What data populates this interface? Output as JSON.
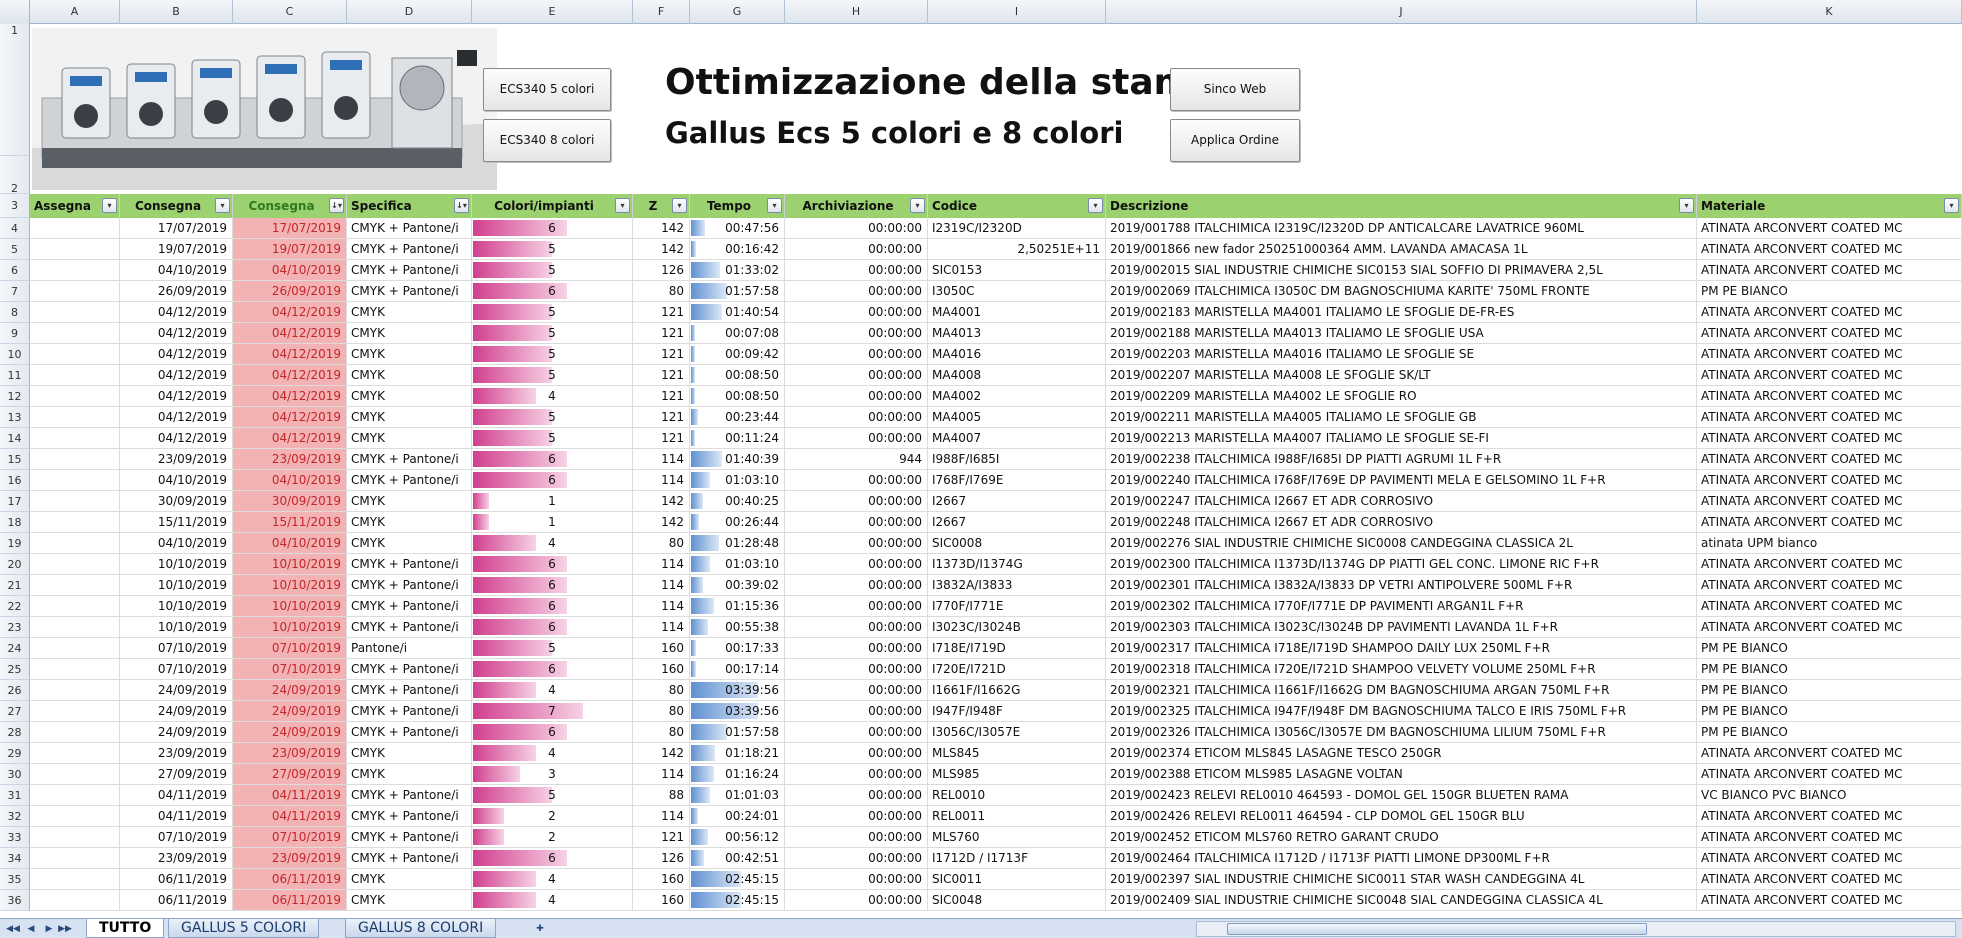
{
  "columns": [
    "A",
    "B",
    "C",
    "D",
    "E",
    "F",
    "G",
    "H",
    "I",
    "J",
    "K"
  ],
  "row_numbers": [
    "1",
    "2",
    "3",
    "4",
    "5",
    "6",
    "7",
    "8",
    "9",
    "10",
    "11",
    "12",
    "13",
    "14",
    "15",
    "16",
    "17",
    "18",
    "19",
    "20",
    "21",
    "22",
    "23",
    "24",
    "25",
    "26",
    "27",
    "28",
    "29",
    "30",
    "31",
    "32",
    "33",
    "34",
    "35",
    "36"
  ],
  "buttons": {
    "ecs5": "ECS340 5 colori",
    "ecs8": "ECS340 8 colori",
    "sinco": "Sinco Web",
    "applica": "Applica Ordine"
  },
  "title": {
    "line1": "Ottimizzazione della stampa",
    "line2": "Gallus Ecs 5 colori e 8 colori"
  },
  "headers": {
    "assegna": "Assegna",
    "consegna": "Consegna",
    "consegna2": "Consegna",
    "specifica": "Specifica",
    "colori": "Colori/impianti",
    "z": "Z",
    "tempo": "Tempo",
    "archiviazione": "Archiviazione",
    "codice": "Codice",
    "descrizione": "Descrizione",
    "materiale": "Materiale"
  },
  "colors": {
    "header_green": "#9bd16f",
    "pink_fill": "#f3b2b4",
    "pink_text": "#c3262b",
    "bar_pink": "#d13f8e",
    "bar_blue": "#5f90d1"
  },
  "rows": [
    {
      "b": "17/07/2019",
      "c": "17/07/2019",
      "d": "CMYK + Pantone/i",
      "e": "6",
      "f": "142",
      "g": "00:47:56",
      "h": "00:00:00",
      "i": "I2319C/I2320D",
      "j": "2019/001788 ITALCHIMICA I2319C/I2320D DP ANTICALCARE LAVATRICE 960ML",
      "k": "ATINATA ARCONVERT COATED MC",
      "t": 0.12
    },
    {
      "b": "19/07/2019",
      "c": "19/07/2019",
      "d": "CMYK + Pantone/i",
      "e": "5",
      "f": "142",
      "g": "00:16:42",
      "h": "00:00:00",
      "i": "2,50251E+11",
      "j": "2019/001866 new fador 250251000364 AMM. LAVANDA AMACASA 1L",
      "k": "ATINATA ARCONVERT COATED MC",
      "t": 0.04
    },
    {
      "b": "04/10/2019",
      "c": "04/10/2019",
      "d": "CMYK + Pantone/i",
      "e": "5",
      "f": "126",
      "g": "01:33:02",
      "h": "00:00:00",
      "i": "SIC0153",
      "j": "2019/002015 SIAL INDUSTRIE CHIMICHE SIC0153 SIAL SOFFIO DI PRIMAVERA 2,5L",
      "k": "ATINATA ARCONVERT COATED MC",
      "t": 0.24
    },
    {
      "b": "26/09/2019",
      "c": "26/09/2019",
      "d": "CMYK + Pantone/i",
      "e": "6",
      "f": "80",
      "g": "01:57:58",
      "h": "00:00:00",
      "i": "I3050C",
      "j": "2019/002069 ITALCHIMICA I3050C DM BAGNOSCHIUMA KARITE' 750ML FRONTE",
      "k": "PM PE BIANCO",
      "t": 0.3
    },
    {
      "b": "04/12/2019",
      "c": "04/12/2019",
      "d": "CMYK",
      "e": "5",
      "f": "121",
      "g": "01:40:54",
      "h": "00:00:00",
      "i": "MA4001",
      "j": "2019/002183 MARISTELLA MA4001 ITALIAMO LE SFOGLIE DE-FR-ES",
      "k": "ATINATA ARCONVERT COATED MC",
      "t": 0.26
    },
    {
      "b": "04/12/2019",
      "c": "04/12/2019",
      "d": "CMYK",
      "e": "5",
      "f": "121",
      "g": "00:07:08",
      "h": "00:00:00",
      "i": "MA4013",
      "j": "2019/002188 MARISTELLA MA4013 ITALIAMO LE SFOGLIE USA",
      "k": "ATINATA ARCONVERT COATED MC",
      "t": 0.02
    },
    {
      "b": "04/12/2019",
      "c": "04/12/2019",
      "d": "CMYK",
      "e": "5",
      "f": "121",
      "g": "00:09:42",
      "h": "00:00:00",
      "i": "MA4016",
      "j": "2019/002203 MARISTELLA MA4016 ITALIAMO LE SFOGLIE SE",
      "k": "ATINATA ARCONVERT COATED MC",
      "t": 0.03
    },
    {
      "b": "04/12/2019",
      "c": "04/12/2019",
      "d": "CMYK",
      "e": "5",
      "f": "121",
      "g": "00:08:50",
      "h": "00:00:00",
      "i": "MA4008",
      "j": "2019/002207 MARISTELLA MA4008 LE SFOGLIE SK/LT",
      "k": "ATINATA ARCONVERT COATED MC",
      "t": 0.02
    },
    {
      "b": "04/12/2019",
      "c": "04/12/2019",
      "d": "CMYK",
      "e": "4",
      "f": "121",
      "g": "00:08:50",
      "h": "00:00:00",
      "i": "MA4002",
      "j": "2019/002209 MARISTELLA MA4002 LE SFOGLIE RO",
      "k": "ATINATA ARCONVERT COATED MC",
      "t": 0.02
    },
    {
      "b": "04/12/2019",
      "c": "04/12/2019",
      "d": "CMYK",
      "e": "5",
      "f": "121",
      "g": "00:23:44",
      "h": "00:00:00",
      "i": "MA4005",
      "j": "2019/002211 MARISTELLA MA4005 ITALIAMO LE SFOGLIE GB",
      "k": "ATINATA ARCONVERT COATED MC",
      "t": 0.06
    },
    {
      "b": "04/12/2019",
      "c": "04/12/2019",
      "d": "CMYK",
      "e": "5",
      "f": "121",
      "g": "00:11:24",
      "h": "00:00:00",
      "i": "MA4007",
      "j": "2019/002213 MARISTELLA MA4007 ITALIAMO LE SFOGLIE SE-FI",
      "k": "ATINATA ARCONVERT COATED MC",
      "t": 0.03
    },
    {
      "b": "23/09/2019",
      "c": "23/09/2019",
      "d": "CMYK + Pantone/i",
      "e": "6",
      "f": "114",
      "g": "01:40:39",
      "h": "944",
      "i": "I988F/I685I",
      "j": "2019/002238 ITALCHIMICA I988F/I685I DP PIATTI AGRUMI 1L F+R",
      "k": "ATINATA ARCONVERT COATED MC",
      "t": 0.26
    },
    {
      "b": "04/10/2019",
      "c": "04/10/2019",
      "d": "CMYK + Pantone/i",
      "e": "6",
      "f": "114",
      "g": "01:03:10",
      "h": "00:00:00",
      "i": "I768F/I769E",
      "j": "2019/002240 ITALCHIMICA I768F/I769E DP PAVIMENTI MELA E GELSOMINO 1L F+R",
      "k": "ATINATA ARCONVERT COATED MC",
      "t": 0.16
    },
    {
      "b": "30/09/2019",
      "c": "30/09/2019",
      "d": "CMYK",
      "e": "1",
      "f": "142",
      "g": "00:40:25",
      "h": "00:00:00",
      "i": "I2667",
      "j": "2019/002247 ITALCHIMICA I2667 ET ADR CORROSIVO",
      "k": "ATINATA ARCONVERT COATED MC",
      "t": 0.1
    },
    {
      "b": "15/11/2019",
      "c": "15/11/2019",
      "d": "CMYK",
      "e": "1",
      "f": "142",
      "g": "00:26:44",
      "h": "00:00:00",
      "i": "I2667",
      "j": "2019/002248 ITALCHIMICA I2667 ET ADR CORROSIVO",
      "k": "ATINATA ARCONVERT COATED MC",
      "t": 0.07
    },
    {
      "b": "04/10/2019",
      "c": "04/10/2019",
      "d": "CMYK",
      "e": "4",
      "f": "80",
      "g": "01:28:48",
      "h": "00:00:00",
      "i": "SIC0008",
      "j": "2019/002276 SIAL INDUSTRIE CHIMICHE SIC0008 CANDEGGINA CLASSICA 2L",
      "k": "atinata UPM bianco",
      "t": 0.23
    },
    {
      "b": "10/10/2019",
      "c": "10/10/2019",
      "d": "CMYK + Pantone/i",
      "e": "6",
      "f": "114",
      "g": "01:03:10",
      "h": "00:00:00",
      "i": "I1373D/I1374G",
      "j": "2019/002300 ITALCHIMICA I1373D/I1374G DP PIATTI GEL CONC. LIMONE RIC F+R",
      "k": "ATINATA ARCONVERT COATED MC",
      "t": 0.16
    },
    {
      "b": "10/10/2019",
      "c": "10/10/2019",
      "d": "CMYK + Pantone/i",
      "e": "6",
      "f": "114",
      "g": "00:39:02",
      "h": "00:00:00",
      "i": "I3832A/I3833",
      "j": "2019/002301 ITALCHIMICA I3832A/I3833 DP VETRI ANTIPOLVERE 500ML F+R",
      "k": "ATINATA ARCONVERT COATED MC",
      "t": 0.1
    },
    {
      "b": "10/10/2019",
      "c": "10/10/2019",
      "d": "CMYK + Pantone/i",
      "e": "6",
      "f": "114",
      "g": "01:15:36",
      "h": "00:00:00",
      "i": "I770F/I771E",
      "j": "2019/002302 ITALCHIMICA I770F/I771E DP PAVIMENTI ARGAN1L F+R",
      "k": "ATINATA ARCONVERT COATED MC",
      "t": 0.19
    },
    {
      "b": "10/10/2019",
      "c": "10/10/2019",
      "d": "CMYK + Pantone/i",
      "e": "6",
      "f": "114",
      "g": "00:55:38",
      "h": "00:00:00",
      "i": "I3023C/I3024B",
      "j": "2019/002303 ITALCHIMICA I3023C/I3024B DP PAVIMENTI LAVANDA 1L F+R",
      "k": "ATINATA ARCONVERT COATED MC",
      "t": 0.14
    },
    {
      "b": "07/10/2019",
      "c": "07/10/2019",
      "d": "Pantone/i",
      "e": "5",
      "f": "160",
      "g": "00:17:33",
      "h": "00:00:00",
      "i": "I718E/I719D",
      "j": "2019/002317 ITALCHIMICA I718E/I719D SHAMPOO DAILY LUX 250ML F+R",
      "k": "PM PE BIANCO",
      "t": 0.04
    },
    {
      "b": "07/10/2019",
      "c": "07/10/2019",
      "d": "CMYK + Pantone/i",
      "e": "6",
      "f": "160",
      "g": "00:17:14",
      "h": "00:00:00",
      "i": "I720E/I721D",
      "j": "2019/002318 ITALCHIMICA I720E/I721D SHAMPOO VELVETY VOLUME 250ML F+R",
      "k": "PM PE BIANCO",
      "t": 0.04
    },
    {
      "b": "24/09/2019",
      "c": "24/09/2019",
      "d": "CMYK + Pantone/i",
      "e": "4",
      "f": "80",
      "g": "03:39:56",
      "h": "00:00:00",
      "i": "I1661F/I1662G",
      "j": "2019/002321 ITALCHIMICA I1661F/I1662G DM BAGNOSCHIUMA ARGAN 750ML F+R",
      "k": "PM PE BIANCO",
      "t": 0.56
    },
    {
      "b": "24/09/2019",
      "c": "24/09/2019",
      "d": "CMYK + Pantone/i",
      "e": "7",
      "f": "80",
      "g": "03:39:56",
      "h": "00:00:00",
      "i": "I947F/I948F",
      "j": "2019/002325 ITALCHIMICA I947F/I948F DM BAGNOSCHIUMA TALCO E IRIS 750ML F+R",
      "k": "PM PE BIANCO",
      "t": 0.56
    },
    {
      "b": "24/09/2019",
      "c": "24/09/2019",
      "d": "CMYK + Pantone/i",
      "e": "6",
      "f": "80",
      "g": "01:57:58",
      "h": "00:00:00",
      "i": "I3056C/I3057E",
      "j": "2019/002326 ITALCHIMICA I3056C/I3057E DM BAGNOSCHIUMA LILIUM 750ML F+R",
      "k": "PM PE BIANCO",
      "t": 0.3
    },
    {
      "b": "23/09/2019",
      "c": "23/09/2019",
      "d": "CMYK",
      "e": "4",
      "f": "142",
      "g": "01:18:21",
      "h": "00:00:00",
      "i": "MLS845",
      "j": "2019/002374 ETICOM MLS845 LASAGNE TESCO 250GR",
      "k": "ATINATA ARCONVERT COATED MC",
      "t": 0.2
    },
    {
      "b": "27/09/2019",
      "c": "27/09/2019",
      "d": "CMYK",
      "e": "3",
      "f": "114",
      "g": "01:16:24",
      "h": "00:00:00",
      "i": "MLS985",
      "j": "2019/002388 ETICOM MLS985 LASAGNE VOLTAN",
      "k": "ATINATA ARCONVERT COATED MC",
      "t": 0.19
    },
    {
      "b": "04/11/2019",
      "c": "04/11/2019",
      "d": "CMYK + Pantone/i",
      "e": "5",
      "f": "88",
      "g": "01:01:03",
      "h": "00:00:00",
      "i": "REL0010",
      "j": "2019/002423 RELEVI REL0010 464593 - DOMOL GEL 150GR BLUETEN RAMA",
      "k": "VC BIANCO PVC BIANCO",
      "t": 0.16
    },
    {
      "b": "04/11/2019",
      "c": "04/11/2019",
      "d": "CMYK + Pantone/i",
      "e": "2",
      "f": "114",
      "g": "00:24:01",
      "h": "00:00:00",
      "i": "REL0011",
      "j": "2019/002426 RELEVI REL0011 464594 - CLP DOMOL GEL 150GR BLU",
      "k": "ATINATA ARCONVERT COATED MC",
      "t": 0.06
    },
    {
      "b": "07/10/2019",
      "c": "07/10/2019",
      "d": "CMYK + Pantone/i",
      "e": "2",
      "f": "121",
      "g": "00:56:12",
      "h": "00:00:00",
      "i": "MLS760",
      "j": "2019/002452 ETICOM MLS760 RETRO GARANT CRUDO",
      "k": "ATINATA ARCONVERT COATED MC",
      "t": 0.14
    },
    {
      "b": "23/09/2019",
      "c": "23/09/2019",
      "d": "CMYK + Pantone/i",
      "e": "6",
      "f": "126",
      "g": "00:42:51",
      "h": "00:00:00",
      "i": "I1712D / I1713F",
      "j": "2019/002464 ITALCHIMICA I1712D / I1713F PIATTI LIMONE DP300ML F+R",
      "k": "ATINATA ARCONVERT COATED MC",
      "t": 0.11
    },
    {
      "b": "06/11/2019",
      "c": "06/11/2019",
      "d": "CMYK",
      "e": "4",
      "f": "160",
      "g": "02:45:15",
      "h": "00:00:00",
      "i": "SIC0011",
      "j": "2019/002397 SIAL INDUSTRIE CHIMICHE SIC0011 STAR WASH CANDEGGINA 4L",
      "k": "ATINATA ARCONVERT COATED MC",
      "t": 0.42
    },
    {
      "b": "06/11/2019",
      "c": "06/11/2019",
      "d": "CMYK",
      "e": "4",
      "f": "160",
      "g": "02:45:15",
      "h": "00:00:00",
      "i": "SIC0048",
      "j": "2019/002409 SIAL INDUSTRIE CHIMICHE SIC0048 SIAL CANDEGGINA CLASSICA 4L",
      "k": "ATINATA ARCONVERT COATED MC",
      "t": 0.42
    }
  ],
  "tabs": [
    "TUTTO",
    "GALLUS 5 COLORI",
    "GALLUS 8 COLORI"
  ],
  "active_tab": 0
}
